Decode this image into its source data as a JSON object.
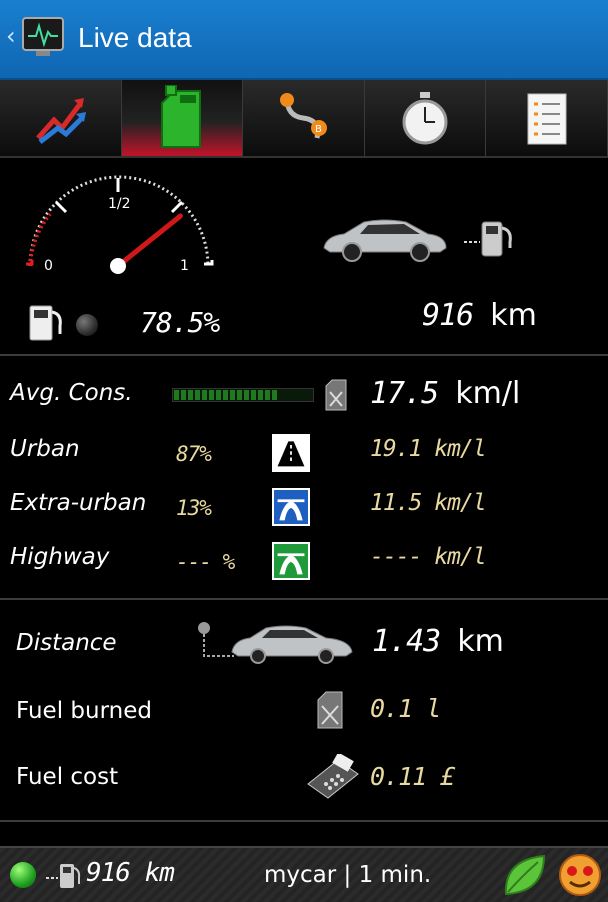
{
  "header": {
    "title": "Live data",
    "back_icon": "chevron-left-icon",
    "app_icon": "monitor-pulse-icon"
  },
  "tabs": [
    {
      "icon": "trend-arrows-icon",
      "active": false
    },
    {
      "icon": "fuel-can-icon",
      "active": true
    },
    {
      "icon": "route-icon",
      "active": false
    },
    {
      "icon": "stopwatch-icon",
      "active": false
    },
    {
      "icon": "checklist-icon",
      "active": false
    }
  ],
  "gauge": {
    "label_empty": "0",
    "label_half": "1/2",
    "label_full": "1",
    "level": 0.785
  },
  "fuel": {
    "level": "78.5%"
  },
  "range": {
    "value": "916",
    "unit": "km"
  },
  "consumption": {
    "avg_label": "Avg. Cons.",
    "avg_value": "17.5",
    "avg_unit": "km/l",
    "rows": [
      {
        "label": "Urban",
        "pct": "87%",
        "value": "19.1 km/l",
        "icon": "urban-road-icon"
      },
      {
        "label": "Extra-urban",
        "pct": "13%",
        "value": "11.5 km/l",
        "icon": "motorway-blue-icon"
      },
      {
        "label": "Highway",
        "pct": "--- %",
        "value": "---- km/l",
        "icon": "motorway-green-icon"
      }
    ]
  },
  "trip": {
    "distance_label": "Distance",
    "distance_value": "1.43",
    "distance_unit": "km",
    "fuel_burned_label": "Fuel burned",
    "fuel_burned_value": "0.1 l",
    "fuel_cost_label": "Fuel cost",
    "fuel_cost_value": "0.11 £"
  },
  "status": {
    "range": "916 km",
    "text": "mycar | 1 min."
  },
  "colors": {
    "accent_blue": "#1a7fd0",
    "active_tab_red": "#c0142a",
    "value_beige": "#e8d9a0",
    "bar_green": "#1f7a1f"
  }
}
